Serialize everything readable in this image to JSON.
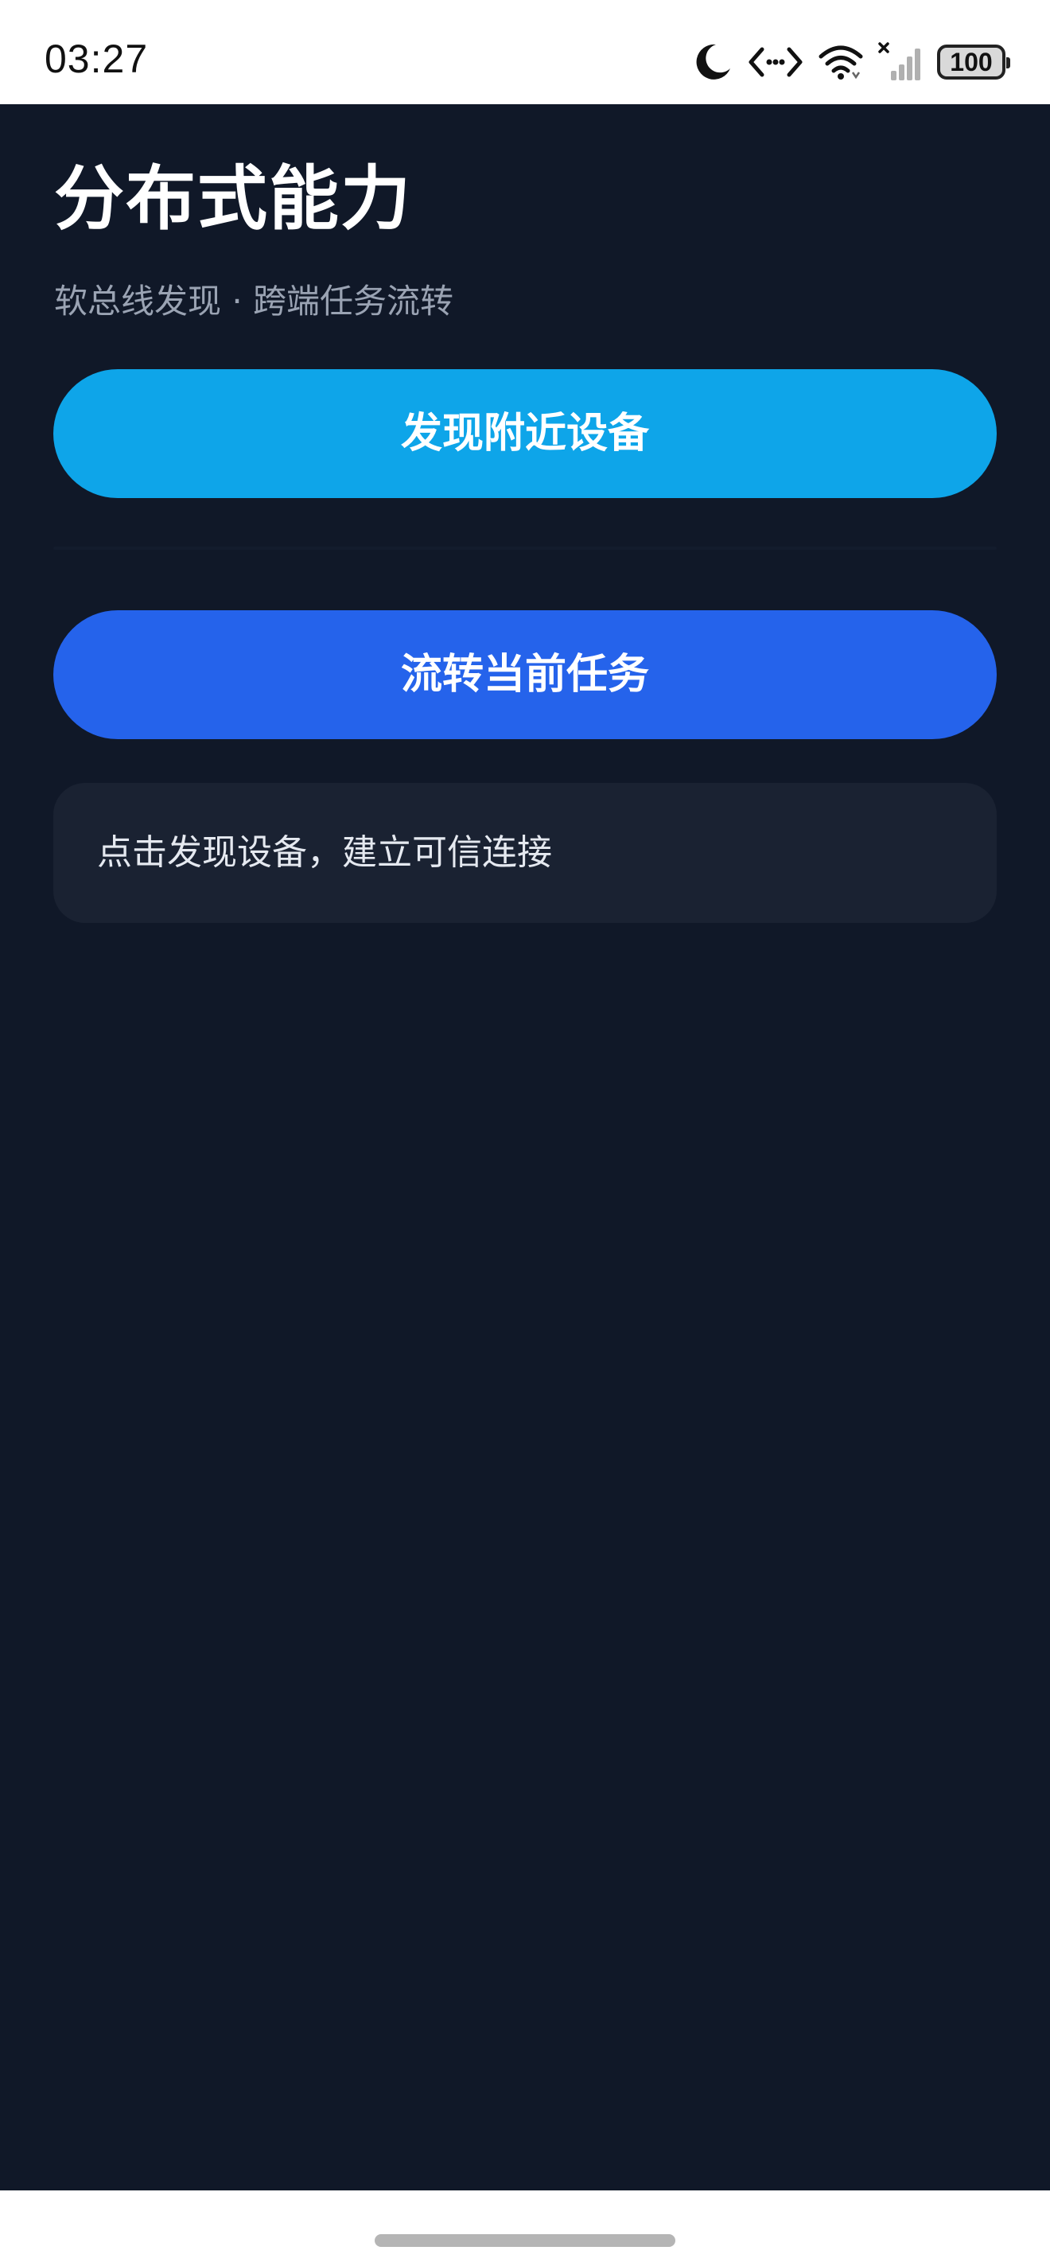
{
  "status_bar": {
    "time": "03:27",
    "battery": "100",
    "icons": [
      "moon-icon",
      "code-arrows-icon",
      "wifi-icon",
      "signal-off-icon",
      "battery-icon"
    ]
  },
  "page": {
    "title": "分布式能力",
    "subtitle": "软总线发现 · 跨端任务流转"
  },
  "actions": {
    "discover_label": "发现附近设备",
    "transfer_label": "流转当前任务"
  },
  "status_card": {
    "message": "点击发现设备，建立可信连接"
  },
  "colors": {
    "background": "#101828",
    "discover_button": "#0ea5e9",
    "transfer_button": "#2563eb",
    "card": "#1a2232"
  }
}
